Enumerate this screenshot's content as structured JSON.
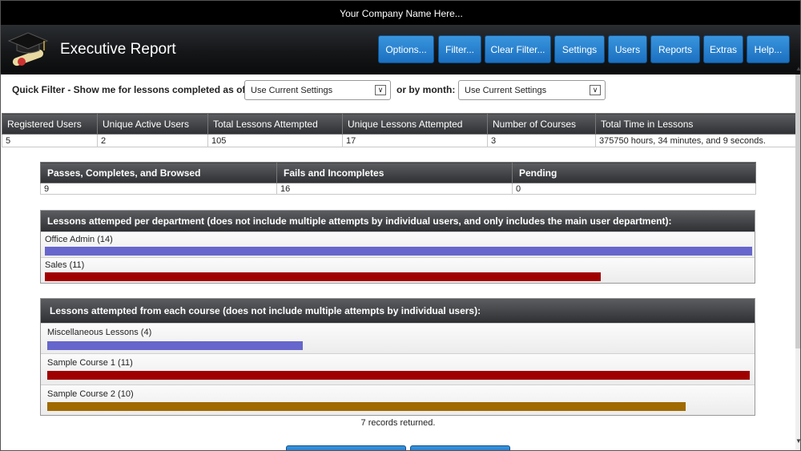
{
  "company_name": "Your Company Name Here...",
  "app_title": "Executive Report",
  "nav": [
    {
      "label": "Options..."
    },
    {
      "label": "Filter..."
    },
    {
      "label": "Clear Filter..."
    },
    {
      "label": "Settings"
    },
    {
      "label": "Users"
    },
    {
      "label": "Reports"
    },
    {
      "label": "Extras"
    },
    {
      "label": "Help..."
    }
  ],
  "quick_filter": {
    "label": "Quick Filter - Show me for lessons completed as of:",
    "select1_value": "Use Current Settings",
    "or_label": "or by month:",
    "select2_value": "Use Current Settings"
  },
  "stats": {
    "headers": [
      "Registered Users",
      "Unique Active Users",
      "Total Lessons Attempted",
      "Unique Lessons Attempted",
      "Number of Courses",
      "Total Time in Lessons"
    ],
    "values": [
      "5",
      "2",
      "105",
      "17",
      "3",
      "375750 hours, 34 minutes, and 9 seconds."
    ]
  },
  "summary": {
    "headers": [
      "Passes, Completes, and Browsed",
      "Fails and Incompletes",
      "Pending"
    ],
    "values": [
      "9",
      "16",
      "0"
    ]
  },
  "department_panel": {
    "title": "Lessons attemped per department (does not include multiple attempts by individual users, and only includes the main user department):",
    "rows": [
      {
        "label": "Office Admin (14)",
        "value": 14,
        "color": "#6666cc"
      },
      {
        "label": "Sales (11)",
        "value": 11,
        "color": "#a00000"
      }
    ],
    "max": 14
  },
  "course_panel": {
    "title": "Lessons attempted from each course (does not include multiple attempts by individual users):",
    "rows": [
      {
        "label": "Miscellaneous Lessons (4)",
        "value": 4,
        "color": "#6666cc"
      },
      {
        "label": "Sample Course 1 (11)",
        "value": 11,
        "color": "#a00000"
      },
      {
        "label": "Sample Course 2 (10)",
        "value": 10,
        "color": "#a06a00"
      }
    ],
    "max": 11
  },
  "records_text": "7 records returned.",
  "icons": {
    "logo": "graduation-cap-diploma-icon",
    "dropdown": "chevron-down-icon"
  },
  "colors": {
    "button": "#1b70c0",
    "header": "#151719"
  }
}
